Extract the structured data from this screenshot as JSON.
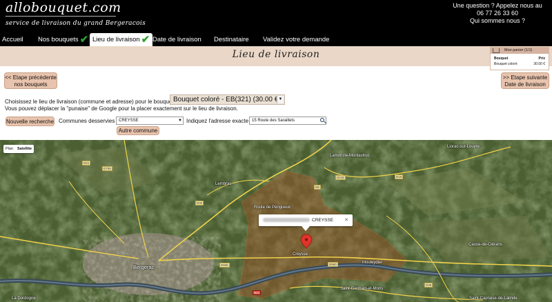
{
  "header": {
    "logo": "allobouquet.com",
    "tagline": "service de livraison du grand Bergeracois",
    "contact_line1": "Une question ? Appelez nous au",
    "phone": "06 77 26 33 60",
    "who": "Qui sommes nous ?"
  },
  "tabs": [
    {
      "label": "Accueil",
      "check": ""
    },
    {
      "label": "Nos bouquets",
      "check": "✔"
    },
    {
      "label": "Lieu de livraison",
      "check": "✔"
    },
    {
      "label": "Date de livraison",
      "check": ""
    },
    {
      "label": "Destinataire",
      "check": ""
    },
    {
      "label": "Validez votre demande",
      "check": ""
    }
  ],
  "page_title": "Lieu de livraison",
  "cart": {
    "title": "Mon panier (1/1)",
    "col_bouquet": "Bouquet",
    "col_price": "Prix",
    "item_name": "Bouquet coloré",
    "item_price": "30.00 €"
  },
  "nav": {
    "prev_line1": "<< Etape précédente",
    "prev_line2": "nos bouquets",
    "next_line1": ">> Etape suivante",
    "next_line2": "Date de livraison"
  },
  "form": {
    "choose_text": "Choisissez le lieu de livraison (commune et adresse) pour le bouquet",
    "bouquet_value": "Bouquet coloré - EB(321) (30.00 €)",
    "move_pin_text": "Vous pouvez déplacer la \"punaise\" de Google pour la placer exactement sur le lieu de livraison.",
    "new_search": "Nouvelle recherche",
    "communes_label": "Communes desservies :",
    "commune_value": "CREYSSE",
    "address_label": "Indiquez l'adresse exacte :",
    "address_value": "15 Route des Saraillets",
    "other_commune": "Autre commune"
  },
  "map": {
    "type_plan": "Plan",
    "type_satellite": "Satellite",
    "bubble_text": "CREYSSE",
    "close": "✕",
    "places": [
      "Lembras",
      "Lamonzie-Montastruc",
      "Liorac-sur-Louyre",
      "Mouleydier",
      "Creysse",
      "Bergerac",
      "Saint-Germain-et-Mons",
      "Cause-de-Clérans",
      "La Dordogne",
      "Saint-Capraise-de-Lalinde",
      "Route de Périgueux"
    ],
    "roads": [
      "D21",
      "D32",
      "D21E",
      "D660",
      "D936",
      "N21",
      "D36",
      "D709",
      "D8",
      "D19"
    ]
  }
}
